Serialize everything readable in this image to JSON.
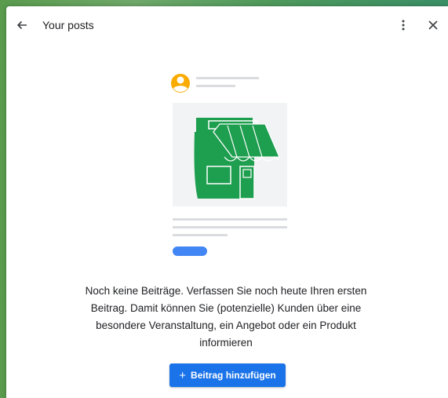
{
  "header": {
    "title": "Your posts",
    "back_icon": "arrow-left-icon",
    "more_icon": "more-vert-icon",
    "close_icon": "close-icon"
  },
  "empty_state": {
    "illustration": "storefront-post-icon",
    "message": "Noch keine Beiträge. Verfassen Sie noch heute Ihren ersten Beitrag. Damit können Sie (potenzielle) Kunden über eine besondere Veranstaltung, ein Angebot oder ein Produkt informieren"
  },
  "actions": {
    "add_post_label": "Beitrag hinzufügen",
    "add_post_icon": "plus-icon"
  },
  "colors": {
    "accent": "#1a73e8",
    "store_green": "#1e9e4f",
    "avatar_yellow": "#f9ab00"
  }
}
